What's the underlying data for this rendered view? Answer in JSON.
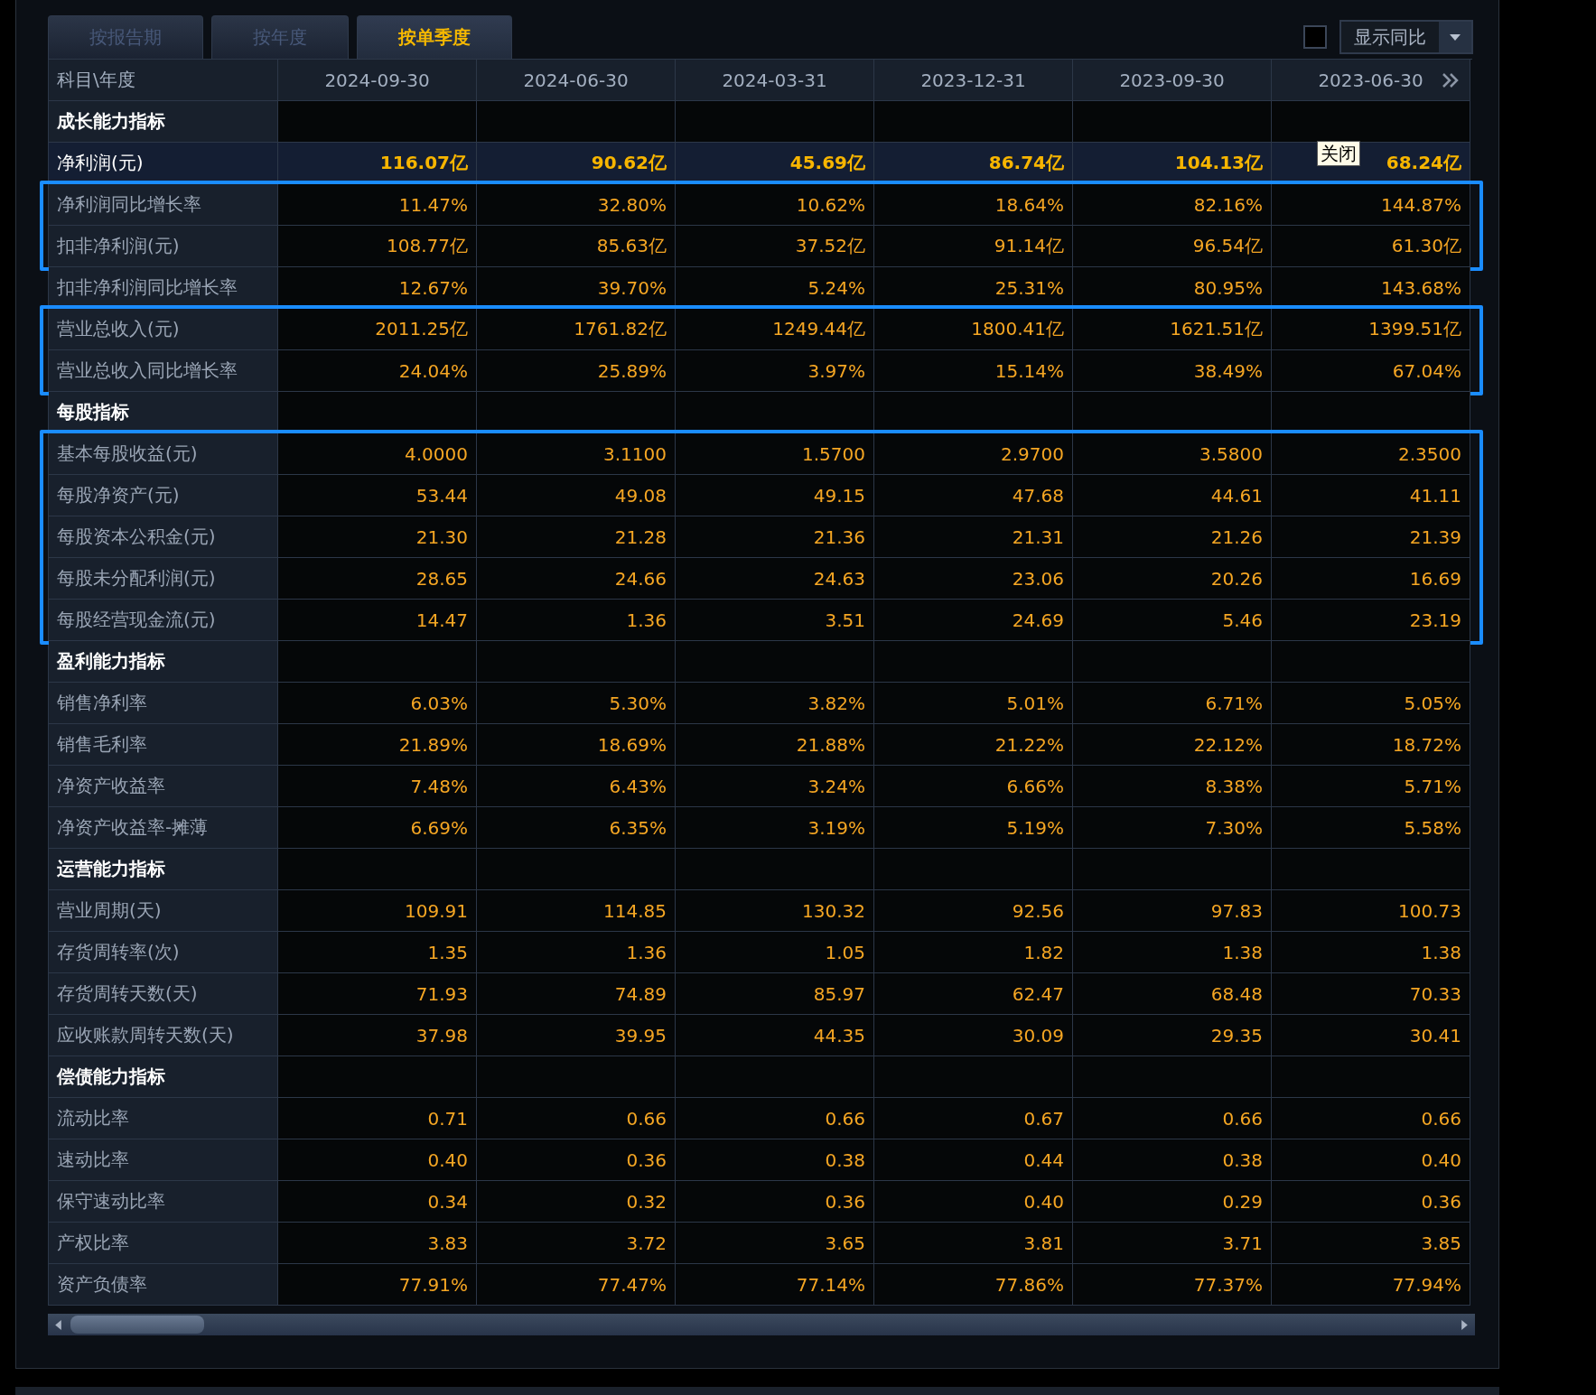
{
  "tabs": [
    {
      "label": "按报告期",
      "selected": false
    },
    {
      "label": "按年度",
      "selected": false
    },
    {
      "label": "按单季度",
      "selected": true
    }
  ],
  "compare_toggle": {
    "checked": false,
    "label": "显示同比"
  },
  "table": {
    "columns": [
      "科目\\年度",
      "2024-09-30",
      "2024-06-30",
      "2024-03-31",
      "2023-12-31",
      "2023-09-30",
      "2023-06-30"
    ],
    "rows": [
      {
        "kind": "section",
        "label": "成长能力指标",
        "highlighted": false
      },
      {
        "kind": "key",
        "label": "净利润(元)",
        "highlighted": false,
        "values": [
          "116.07亿",
          "90.62亿",
          "45.69亿",
          "86.74亿",
          "104.13亿",
          "68.24亿"
        ]
      },
      {
        "kind": "data",
        "label": "净利润同比增长率",
        "highlighted": true,
        "values": [
          "11.47%",
          "32.80%",
          "10.62%",
          "18.64%",
          "82.16%",
          "144.87%"
        ]
      },
      {
        "kind": "data",
        "label": "扣非净利润(元)",
        "highlighted": true,
        "values": [
          "108.77亿",
          "85.63亿",
          "37.52亿",
          "91.14亿",
          "96.54亿",
          "61.30亿"
        ]
      },
      {
        "kind": "data",
        "label": "扣非净利润同比增长率",
        "highlighted": false,
        "values": [
          "12.67%",
          "39.70%",
          "5.24%",
          "25.31%",
          "80.95%",
          "143.68%"
        ]
      },
      {
        "kind": "data",
        "label": "营业总收入(元)",
        "highlighted": true,
        "values": [
          "2011.25亿",
          "1761.82亿",
          "1249.44亿",
          "1800.41亿",
          "1621.51亿",
          "1399.51亿"
        ]
      },
      {
        "kind": "data",
        "label": "营业总收入同比增长率",
        "highlighted": true,
        "values": [
          "24.04%",
          "25.89%",
          "3.97%",
          "15.14%",
          "38.49%",
          "67.04%"
        ]
      },
      {
        "kind": "section",
        "label": "每股指标",
        "highlighted": false
      },
      {
        "kind": "data",
        "label": "基本每股收益(元)",
        "highlighted": true,
        "values": [
          "4.0000",
          "3.1100",
          "1.5700",
          "2.9700",
          "3.5800",
          "2.3500"
        ]
      },
      {
        "kind": "data",
        "label": "每股净资产(元)",
        "highlighted": true,
        "values": [
          "53.44",
          "49.08",
          "49.15",
          "47.68",
          "44.61",
          "41.11"
        ]
      },
      {
        "kind": "data",
        "label": "每股资本公积金(元)",
        "highlighted": true,
        "values": [
          "21.30",
          "21.28",
          "21.36",
          "21.31",
          "21.26",
          "21.39"
        ]
      },
      {
        "kind": "data",
        "label": "每股未分配利润(元)",
        "highlighted": true,
        "values": [
          "28.65",
          "24.66",
          "24.63",
          "23.06",
          "20.26",
          "16.69"
        ]
      },
      {
        "kind": "data",
        "label": "每股经营现金流(元)",
        "highlighted": true,
        "values": [
          "14.47",
          "1.36",
          "3.51",
          "24.69",
          "5.46",
          "23.19"
        ]
      },
      {
        "kind": "section",
        "label": "盈利能力指标",
        "highlighted": false
      },
      {
        "kind": "data",
        "label": "销售净利率",
        "highlighted": false,
        "values": [
          "6.03%",
          "5.30%",
          "3.82%",
          "5.01%",
          "6.71%",
          "5.05%"
        ]
      },
      {
        "kind": "data",
        "label": "销售毛利率",
        "highlighted": false,
        "values": [
          "21.89%",
          "18.69%",
          "21.88%",
          "21.22%",
          "22.12%",
          "18.72%"
        ]
      },
      {
        "kind": "data",
        "label": "净资产收益率",
        "highlighted": false,
        "values": [
          "7.48%",
          "6.43%",
          "3.24%",
          "6.66%",
          "8.38%",
          "5.71%"
        ]
      },
      {
        "kind": "data",
        "label": "净资产收益率-摊薄",
        "highlighted": false,
        "values": [
          "6.69%",
          "6.35%",
          "3.19%",
          "5.19%",
          "7.30%",
          "5.58%"
        ]
      },
      {
        "kind": "section",
        "label": "运营能力指标",
        "highlighted": false
      },
      {
        "kind": "data",
        "label": "营业周期(天)",
        "highlighted": false,
        "values": [
          "109.91",
          "114.85",
          "130.32",
          "92.56",
          "97.83",
          "100.73"
        ]
      },
      {
        "kind": "data",
        "label": "存货周转率(次)",
        "highlighted": false,
        "values": [
          "1.35",
          "1.36",
          "1.05",
          "1.82",
          "1.38",
          "1.38"
        ]
      },
      {
        "kind": "data",
        "label": "存货周转天数(天)",
        "highlighted": false,
        "values": [
          "71.93",
          "74.89",
          "85.97",
          "62.47",
          "68.48",
          "70.33"
        ]
      },
      {
        "kind": "data",
        "label": "应收账款周转天数(天)",
        "highlighted": false,
        "values": [
          "37.98",
          "39.95",
          "44.35",
          "30.09",
          "29.35",
          "30.41"
        ]
      },
      {
        "kind": "section",
        "label": "偿债能力指标",
        "highlighted": false
      },
      {
        "kind": "data",
        "label": "流动比率",
        "highlighted": false,
        "values": [
          "0.71",
          "0.66",
          "0.66",
          "0.67",
          "0.66",
          "0.66"
        ]
      },
      {
        "kind": "data",
        "label": "速动比率",
        "highlighted": false,
        "values": [
          "0.40",
          "0.36",
          "0.38",
          "0.44",
          "0.38",
          "0.40"
        ]
      },
      {
        "kind": "data",
        "label": "保守速动比率",
        "highlighted": false,
        "values": [
          "0.34",
          "0.32",
          "0.36",
          "0.40",
          "0.29",
          "0.36"
        ]
      },
      {
        "kind": "data",
        "label": "产权比率",
        "highlighted": false,
        "values": [
          "3.83",
          "3.72",
          "3.65",
          "3.81",
          "3.71",
          "3.85"
        ]
      },
      {
        "kind": "data",
        "label": "资产负债率",
        "highlighted": false,
        "values": [
          "77.91%",
          "77.47%",
          "77.14%",
          "77.86%",
          "77.37%",
          "77.94%"
        ]
      }
    ]
  },
  "tooltip": "关闭"
}
